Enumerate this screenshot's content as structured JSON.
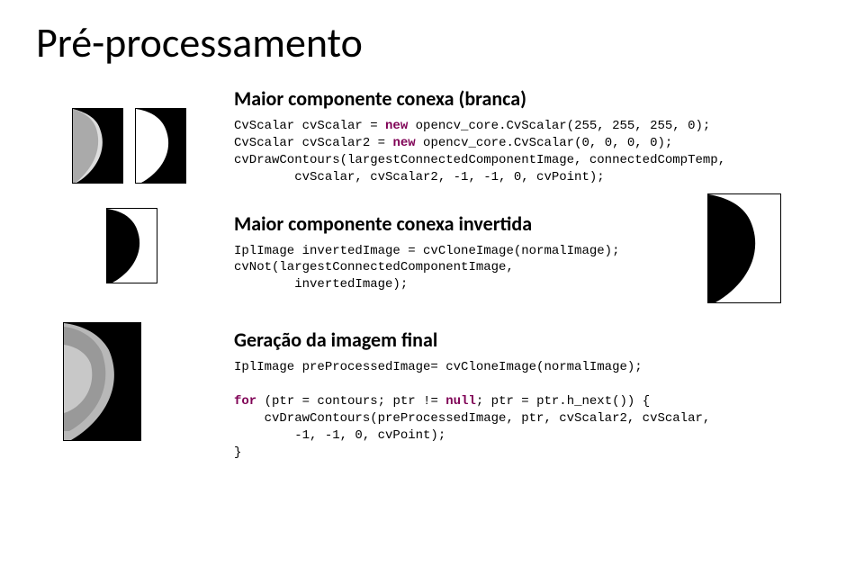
{
  "title": "Pré-processamento",
  "section1": {
    "heading": "Maior componente conexa (branca)",
    "code_l1a": "CvScalar cvScalar = ",
    "code_l1_kw": "new",
    "code_l1b": " opencv_core.CvScalar(255, 255, 255, 0);",
    "code_l2a": "CvScalar cvScalar2 = ",
    "code_l2_kw": "new",
    "code_l2b": " opencv_core.CvScalar(0, 0, 0, 0);",
    "code_l3": "cvDrawContours(largestConnectedComponentImage, connectedCompTemp,",
    "code_l4": "        cvScalar, cvScalar2, -1, -1, 0, cvPoint);"
  },
  "section2": {
    "heading": "Maior componente conexa invertida",
    "code_l1": "IplImage invertedImage = cvCloneImage(normalImage);",
    "code_l2": "cvNot(largestConnectedComponentImage,",
    "code_l3": "        invertedImage);"
  },
  "section3": {
    "heading": "Geração da imagem final",
    "code_l1": "IplImage preProcessedImage= cvCloneImage(normalImage);",
    "code_blank": "",
    "code_l2_kw": "for",
    "code_l2a": " (ptr = contours; ptr != ",
    "code_l2_kw2": "null",
    "code_l2b": "; ptr = ptr.h_next()) {",
    "code_l3": "    cvDrawContours(preProcessedImage, ptr, cvScalar2, cvScalar,",
    "code_l4": "        -1, -1, 0, cvPoint);",
    "code_l5": "}"
  }
}
